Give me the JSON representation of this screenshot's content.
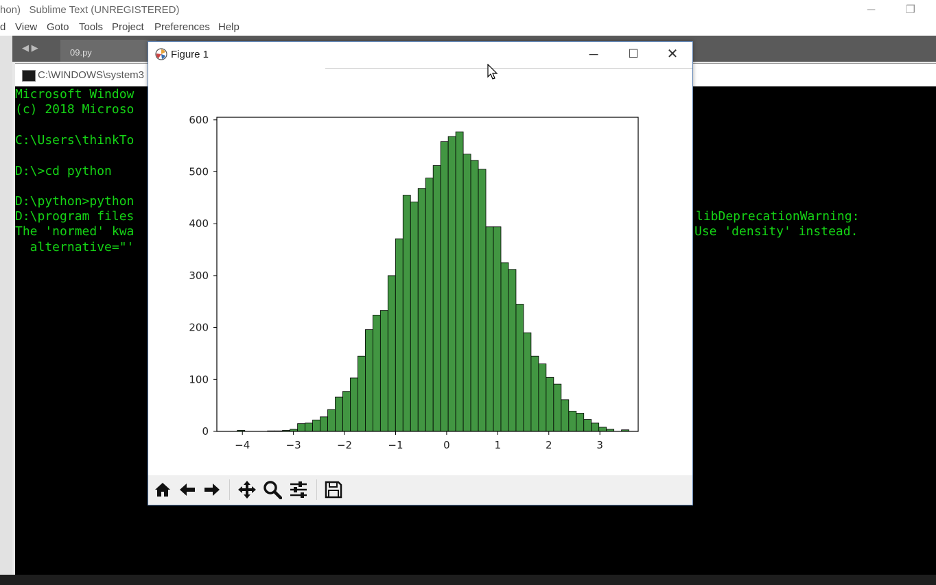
{
  "sublime": {
    "title": "hon)   Sublime Text (UNREGISTERED)",
    "menu": [
      "d",
      "View",
      "Goto",
      "Tools",
      "Project",
      "Preferences",
      "Help"
    ],
    "tab_label": "09.py"
  },
  "cmd": {
    "title": "C:\\WINDOWS\\system3",
    "lines_left": [
      "Microsoft Window",
      "(c) 2018 Microso",
      "",
      "C:\\Users\\thinkTo",
      "",
      "D:\\>cd python",
      "",
      "D:\\python>python",
      "D:\\program files",
      "The 'normed' kwa",
      "  alternative=\"'"
    ],
    "lines_right": [
      "libDeprecationWarning:",
      "Use 'density' instead."
    ]
  },
  "figure": {
    "title": "Figure 1",
    "toolbar": [
      "home-icon",
      "back-arrow-icon",
      "forward-arrow-icon",
      "pan-icon",
      "zoom-icon",
      "configure-subplots-icon",
      "save-icon"
    ]
  },
  "chart_data": {
    "type": "bar",
    "title": "",
    "xlabel": "",
    "ylabel": "",
    "xlim": [
      -4.5,
      3.75
    ],
    "ylim": [
      0,
      605
    ],
    "xticks": [
      -4,
      -3,
      -2,
      -1,
      0,
      1,
      2,
      3
    ],
    "xtick_labels": [
      "−4",
      "−3",
      "−2",
      "−1",
      "0",
      "1",
      "2",
      "3"
    ],
    "yticks": [
      0,
      100,
      200,
      300,
      400,
      500,
      600
    ],
    "ytick_labels": [
      "0",
      "100",
      "200",
      "300",
      "400",
      "500",
      "600"
    ],
    "bar_color": "#2e8b2e",
    "edge_color": "#000000",
    "bin_edges_start": -4.1,
    "bin_width": 0.1475,
    "counts": [
      2,
      0,
      0,
      0,
      1,
      1,
      2,
      4,
      15,
      16,
      22,
      28,
      42,
      66,
      77,
      103,
      145,
      196,
      224,
      233,
      300,
      371,
      455,
      442,
      468,
      488,
      512,
      558,
      568,
      577,
      534,
      522,
      505,
      394,
      394,
      325,
      312,
      245,
      190,
      145,
      130,
      104,
      91,
      61,
      39,
      35,
      23,
      16,
      8,
      4,
      0,
      3
    ]
  }
}
